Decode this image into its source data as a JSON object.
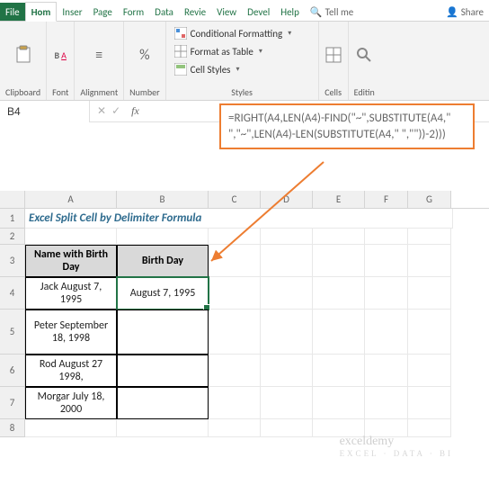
{
  "tabs": {
    "file": "File",
    "home": "Hom",
    "insert": "Inser",
    "page": "Page",
    "form": "Form",
    "data": "Data",
    "review": "Revie",
    "view": "View",
    "devel": "Devel",
    "help": "Help",
    "tellme": "Tell me",
    "share": "Share"
  },
  "ribbon": {
    "clipboard": "Clipboard",
    "font": "Font",
    "alignment": "Alignment",
    "number": "Number",
    "cond_fmt": "Conditional Formatting",
    "fmt_table": "Format as Table",
    "cell_styles": "Cell Styles",
    "styles": "Styles",
    "cells": "Cells",
    "editing": "Editin"
  },
  "namebox": "B4",
  "formula": "=RIGHT(A4,LEN(A4)-FIND(\"~\",SUBSTITUTE(A4,\" \",\"~\",LEN(A4)-LEN(SUBSTITUTE(A4,\" \",\"\"))-2)))",
  "columns": [
    "A",
    "B",
    "C",
    "D",
    "E",
    "F",
    "G"
  ],
  "rows": [
    "1",
    "2",
    "3",
    "4",
    "5",
    "6",
    "7",
    "8"
  ],
  "sheet": {
    "title": "Excel Split Cell by Delimiter Formula",
    "hdr_a": "Name with Birth Day",
    "hdr_b": "Birth Day",
    "a4": "Jack August 7, 1995",
    "b4": "August 7, 1995",
    "a5": "Peter September 18, 1998",
    "a6": "Rod August 27 1998,",
    "a7": "Morgar July 18, 2000"
  },
  "watermark": {
    "main": "exceldemy",
    "sub": "EXCEL · DATA · BI"
  },
  "symbols": {
    "percent": "%",
    "search": "🔍",
    "share": "👤",
    "down": "▾",
    "check": "✓",
    "x": "✕",
    "bold": "B",
    "underline": "A",
    "equals": "≡"
  }
}
